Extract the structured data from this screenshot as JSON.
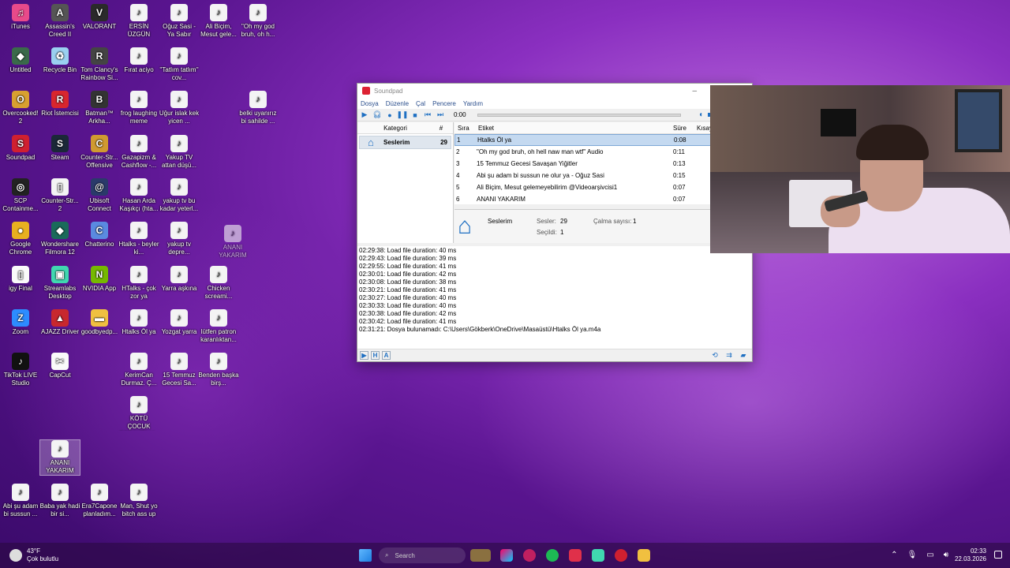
{
  "desktop_icons": [
    {
      "label": "iTunes",
      "col": 0,
      "row": 0,
      "color": "#e84a8a",
      "glyph": "♫"
    },
    {
      "label": "Untitled",
      "col": 0,
      "row": 1,
      "color": "#3a6a4a",
      "glyph": "◆"
    },
    {
      "label": "Overcooked! 2",
      "col": 0,
      "row": 2,
      "color": "#d8a030",
      "glyph": "O"
    },
    {
      "label": "Soundpad",
      "col": 0,
      "row": 3,
      "color": "#d02030",
      "glyph": "S"
    },
    {
      "label": "SCP Containme...",
      "col": 0,
      "row": 4,
      "color": "#222",
      "glyph": "◎"
    },
    {
      "label": "Google Chrome",
      "col": 0,
      "row": 5,
      "color": "#e8b020",
      "glyph": "●"
    },
    {
      "label": "igy Final",
      "col": 0,
      "row": 6,
      "color": "#fafafa",
      "glyph": "▯"
    },
    {
      "label": "Zoom",
      "col": 0,
      "row": 7,
      "color": "#2d8cff",
      "glyph": "Z"
    },
    {
      "label": "TikTok LIVE Studio",
      "col": 0,
      "row": 8,
      "color": "#111",
      "glyph": "♪"
    },
    {
      "label": "Assassin's Creed II",
      "col": 1,
      "row": 0,
      "color": "#555",
      "glyph": "A"
    },
    {
      "label": "Recycle Bin",
      "col": 1,
      "row": 1,
      "color": "#9ad0f0",
      "glyph": "♻"
    },
    {
      "label": "Riot İstemcisi",
      "col": 1,
      "row": 2,
      "color": "#d8262e",
      "glyph": "R"
    },
    {
      "label": "Steam",
      "col": 1,
      "row": 3,
      "color": "#1b2838",
      "glyph": "S"
    },
    {
      "label": "Counter-Str... 2",
      "col": 1,
      "row": 4,
      "color": "#f4f4f4",
      "glyph": "▯"
    },
    {
      "label": "Wondershare Filmora 12",
      "col": 1,
      "row": 5,
      "color": "#1a6a5a",
      "glyph": "◆"
    },
    {
      "label": "Streamlabs Desktop",
      "col": 1,
      "row": 6,
      "color": "#40d8b0",
      "glyph": "▣"
    },
    {
      "label": "AJAZZ Driver",
      "col": 1,
      "row": 7,
      "color": "#c8282e",
      "glyph": "▲"
    },
    {
      "label": "CapCut",
      "col": 1,
      "row": 8,
      "color": "#fafafa",
      "glyph": "✂"
    },
    {
      "label": "VALORANT",
      "col": 2,
      "row": 0,
      "color": "#2a2a2a",
      "glyph": "V"
    },
    {
      "label": "Tom Clancy's Rainbow Si...",
      "col": 2,
      "row": 1,
      "color": "#444",
      "glyph": "R"
    },
    {
      "label": "Batman™ Arkha...",
      "col": 2,
      "row": 2,
      "color": "#333",
      "glyph": "B"
    },
    {
      "label": "Counter-Str... Offensive",
      "col": 2,
      "row": 3,
      "color": "#d09a30",
      "glyph": "C"
    },
    {
      "label": "Ubisoft Connect",
      "col": 2,
      "row": 4,
      "color": "#2a3a6a",
      "glyph": "@"
    },
    {
      "label": "Chatterino",
      "col": 2,
      "row": 5,
      "color": "#5a8ae0",
      "glyph": "C"
    },
    {
      "label": "NVIDIA App",
      "col": 2,
      "row": 6,
      "color": "#76b900",
      "glyph": "N"
    },
    {
      "label": "goodbyedp...",
      "col": 2,
      "row": 7,
      "color": "#f0c040",
      "glyph": "▬"
    },
    {
      "label": "Era7Capone planladım...",
      "col": 2,
      "row": 11,
      "color": "doc",
      "glyph": ""
    },
    {
      "label": "ERSİN ÜZGÜN",
      "col": 3,
      "row": 0,
      "color": "doc",
      "glyph": ""
    },
    {
      "label": "Fırat aciyo",
      "col": 3,
      "row": 1,
      "color": "doc",
      "glyph": ""
    },
    {
      "label": "frog laughing meme",
      "col": 3,
      "row": 2,
      "color": "doc",
      "glyph": ""
    },
    {
      "label": "Gazapizm & Cashflow -...",
      "col": 3,
      "row": 3,
      "color": "doc",
      "glyph": ""
    },
    {
      "label": "Hasan Arda Kaşıkçı (hta...",
      "col": 3,
      "row": 4,
      "color": "doc",
      "glyph": ""
    },
    {
      "label": "Htalks - beyler ki...",
      "col": 3,
      "row": 5,
      "color": "doc",
      "glyph": ""
    },
    {
      "label": "HTalks - çok zor ya",
      "col": 3,
      "row": 6,
      "color": "doc",
      "glyph": ""
    },
    {
      "label": "Htalks Öl ya",
      "col": 3,
      "row": 7,
      "color": "doc",
      "glyph": ""
    },
    {
      "label": "KerimCan Durmaz. Ç...",
      "col": 3,
      "row": 8,
      "color": "doc",
      "glyph": ""
    },
    {
      "label": "KÖTÜ ÇOCUK SOKAKTA V...",
      "col": 3,
      "row": 9,
      "color": "doc",
      "glyph": ""
    },
    {
      "label": "Man, Shut yo bitch ass up",
      "col": 3,
      "row": 11,
      "color": "doc",
      "glyph": ""
    },
    {
      "label": "Oğuz Sasi - Ya Sabır",
      "col": 4,
      "row": 0,
      "color": "doc",
      "glyph": ""
    },
    {
      "label": "''Tatlım tatlım'' cov...",
      "col": 4,
      "row": 1,
      "color": "doc",
      "glyph": ""
    },
    {
      "label": "Uğur islak kek yicen ...",
      "col": 4,
      "row": 2,
      "color": "doc",
      "glyph": ""
    },
    {
      "label": "Yakup TV attan düşü...",
      "col": 4,
      "row": 3,
      "color": "doc",
      "glyph": ""
    },
    {
      "label": "yakup tv bu kadar yeterl...",
      "col": 4,
      "row": 4,
      "color": "doc",
      "glyph": ""
    },
    {
      "label": "yakup tv depre...",
      "col": 4,
      "row": 5,
      "color": "doc",
      "glyph": ""
    },
    {
      "label": "Yarra aşkına",
      "col": 4,
      "row": 6,
      "color": "doc",
      "glyph": ""
    },
    {
      "label": "Yozgat yarra",
      "col": 4,
      "row": 7,
      "color": "doc",
      "glyph": ""
    },
    {
      "label": "15 Temmuz Gecesi Sa...",
      "col": 4,
      "row": 8,
      "color": "doc",
      "glyph": ""
    },
    {
      "label": "Ali Biçim, Mesut gele...",
      "col": 5,
      "row": 0,
      "color": "doc",
      "glyph": ""
    },
    {
      "label": "Chicken screami...",
      "col": 5,
      "row": 6,
      "color": "doc",
      "glyph": ""
    },
    {
      "label": "lütfen patron karanlıktan...",
      "col": 5,
      "row": 7,
      "color": "doc",
      "glyph": ""
    },
    {
      "label": "Benden başka birş...",
      "col": 5,
      "row": 8,
      "color": "doc",
      "glyph": ""
    },
    {
      "label": "\"Oh my god bruh, oh h...",
      "col": 6,
      "row": 0,
      "color": "doc",
      "glyph": ""
    },
    {
      "label": "belki uyanırız bi sahilde ...",
      "col": 6,
      "row": 2,
      "color": "doc",
      "glyph": ""
    },
    {
      "label": "Abi şu adam bi sussun ...",
      "col": 0,
      "row": 11,
      "color": "doc",
      "glyph": ""
    },
    {
      "label": "Baba yak hadi bir si...",
      "col": 1,
      "row": 11,
      "color": "doc",
      "glyph": ""
    }
  ],
  "selected_icon": {
    "label": "ANANI YAKARIM"
  },
  "dragging_icon": {
    "label": "ANANI YAKARIM"
  },
  "soundpad": {
    "title": "Soundpad",
    "menu": [
      "Dosya",
      "Düzenle",
      "Çal",
      "Pencere",
      "Yardım"
    ],
    "time": "0:00",
    "category_header": "Kategori",
    "count_header": "#",
    "category": {
      "name": "Seslerim",
      "count": "29"
    },
    "list_headers": [
      "Sıra",
      "Etiket",
      "Süre",
      "Kısay"
    ],
    "rows": [
      {
        "n": "1",
        "title": "Htalks Öl ya",
        "dur": "0:08",
        "selected": true
      },
      {
        "n": "2",
        "title": "\"Oh my god bruh, oh hell naw man wtf\" Audio",
        "dur": "0:11"
      },
      {
        "n": "3",
        "title": "15 Temmuz Gecesi Savaşan Yiğitler",
        "dur": "0:13"
      },
      {
        "n": "4",
        "title": "Abi şu adam bi sussun ne olur ya - Oğuz Sasi",
        "dur": "0:15"
      },
      {
        "n": "5",
        "title": "Ali Biçim, Mesut gelemeyebilirim @Videoarşivcisi1",
        "dur": "0:07"
      },
      {
        "n": "6",
        "title": "ANANI YAKARIM",
        "dur": "0:07"
      }
    ],
    "info": {
      "name": "Seslerim",
      "sounds_label": "Sesler:",
      "sounds_value": "29",
      "plays_label": "Çalma sayısı:",
      "plays_value": "1",
      "selected_label": "Seçildi:",
      "selected_value": "1"
    },
    "log": [
      "02:29:38: Load file duration: 40 ms",
      "02:29:43: Load file duration: 39 ms",
      "02:29:55: Load file duration: 41 ms",
      "02:30:01: Load file duration: 42 ms",
      "02:30:08: Load file duration: 38 ms",
      "02:30:21: Load file duration: 41 ms",
      "02:30:27: Load file duration: 40 ms",
      "02:30:33: Load file duration: 40 ms",
      "02:30:38: Load file duration: 42 ms",
      "02:30:42: Load file duration: 41 ms",
      "02:31:21: Dosya bulunamadı: C:\\Users\\Gökberk\\OneDrive\\Masaüstü\\Htalks Öl ya.m4a"
    ]
  },
  "taskbar": {
    "temperature": "43°F",
    "weather": "Çok bulutlu",
    "search_placeholder": "Search",
    "time": "02:33",
    "date": "22.03.2026"
  }
}
